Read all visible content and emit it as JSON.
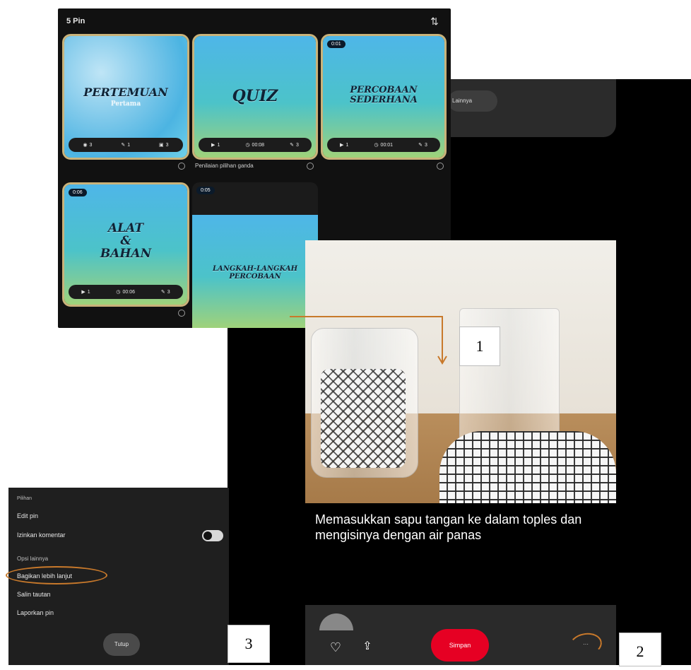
{
  "pins_panel": {
    "title": "5 Pin",
    "pins": [
      {
        "caption": "PERTEMUAN",
        "subcaption": "Pertama",
        "badge": "",
        "stats": [
          "3",
          "1",
          "3"
        ],
        "meta": ""
      },
      {
        "caption": "QUIZ",
        "badge": "",
        "stats": [
          "1",
          "00:08",
          "3"
        ],
        "meta": "Penilaian pilihan ganda"
      },
      {
        "caption": "PERCOBAAN\nSEDERHANA",
        "badge": "0:01",
        "stats": [
          "1",
          "00:01",
          "3"
        ],
        "meta": ""
      },
      {
        "caption": "ALAT\n&\nBAHAN",
        "badge": "0:06",
        "stats": [
          "1",
          "00:06",
          "3"
        ],
        "meta": ""
      },
      {
        "caption": "LANGKAH-LANGKAH\nPERCOBAAN",
        "badge": "0:05",
        "stats": [],
        "meta": ""
      }
    ]
  },
  "comment_card": {
    "pill": "Lainnya"
  },
  "detail": {
    "caption": "Memasukkan sapu tangan ke dalam toples dan mengisinya dengan air panas",
    "save_label": "Simpan",
    "more_label": "···"
  },
  "options": {
    "header": "Pilihan",
    "items": [
      "Edit pin",
      "Izinkan komentar",
      "Opsi lainnya",
      "Bagikan lebih lanjut",
      "Salin tautan",
      "Laporkan pin"
    ],
    "close_label": "Tutup"
  },
  "callouts": [
    "1",
    "2",
    "3"
  ],
  "colors": {
    "save_red": "#e60023",
    "annotation_orange": "#c8792b",
    "pin_border": "#c9b27a"
  },
  "icons": {
    "sort": "sort-icon",
    "heart": "heart-icon",
    "share": "share-icon"
  }
}
